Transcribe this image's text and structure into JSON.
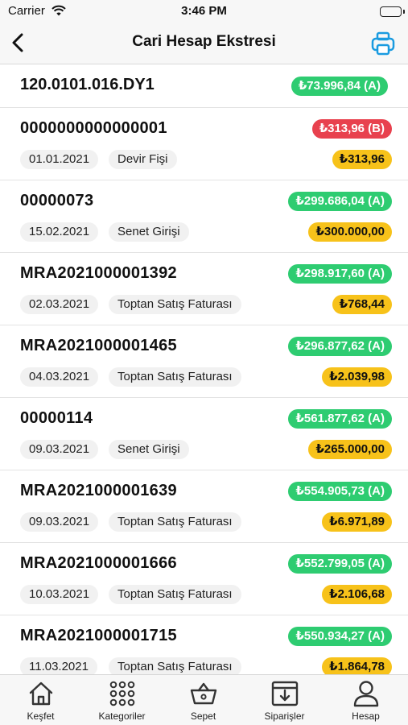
{
  "status_bar": {
    "carrier": "Carrier",
    "time": "3:46 PM"
  },
  "nav": {
    "title": "Cari Hesap Ekstresi"
  },
  "account": {
    "code": "120.0101.016.DY1",
    "balance": "₺73.996,84 (A)"
  },
  "transactions": [
    {
      "doc_no": "0000000000000001",
      "balance": "₺313,96 (B)",
      "balance_status": "debit",
      "date": "01.01.2021",
      "type": "Devir Fişi",
      "amount": "₺313,96"
    },
    {
      "doc_no": "00000073",
      "balance": "₺299.686,04 (A)",
      "balance_status": "credit",
      "date": "15.02.2021",
      "type": "Senet Girişi",
      "amount": "₺300.000,00"
    },
    {
      "doc_no": "MRA2021000001392",
      "balance": "₺298.917,60 (A)",
      "balance_status": "credit",
      "date": "02.03.2021",
      "type": "Toptan Satış Faturası",
      "amount": "₺768,44"
    },
    {
      "doc_no": "MRA2021000001465",
      "balance": "₺296.877,62 (A)",
      "balance_status": "credit",
      "date": "04.03.2021",
      "type": "Toptan Satış Faturası",
      "amount": "₺2.039,98"
    },
    {
      "doc_no": "00000114",
      "balance": "₺561.877,62 (A)",
      "balance_status": "credit",
      "date": "09.03.2021",
      "type": "Senet Girişi",
      "amount": "₺265.000,00"
    },
    {
      "doc_no": "MRA2021000001639",
      "balance": "₺554.905,73 (A)",
      "balance_status": "credit",
      "date": "09.03.2021",
      "type": "Toptan Satış Faturası",
      "amount": "₺6.971,89"
    },
    {
      "doc_no": "MRA2021000001666",
      "balance": "₺552.799,05 (A)",
      "balance_status": "credit",
      "date": "10.03.2021",
      "type": "Toptan Satış Faturası",
      "amount": "₺2.106,68"
    },
    {
      "doc_no": "MRA2021000001715",
      "balance": "₺550.934,27 (A)",
      "balance_status": "credit",
      "date": "11.03.2021",
      "type": "Toptan Satış Faturası",
      "amount": "₺1.864,78"
    }
  ],
  "tabs": [
    {
      "label": "Keşfet",
      "icon": "home-icon"
    },
    {
      "label": "Kategoriler",
      "icon": "grid-icon"
    },
    {
      "label": "Sepet",
      "icon": "basket-icon"
    },
    {
      "label": "Siparişler",
      "icon": "orders-icon"
    },
    {
      "label": "Hesap",
      "icon": "user-icon"
    }
  ],
  "colors": {
    "credit": "#2ecc71",
    "debit": "#e8414e",
    "amount": "#f7c21a",
    "accent": "#1a9be0"
  }
}
